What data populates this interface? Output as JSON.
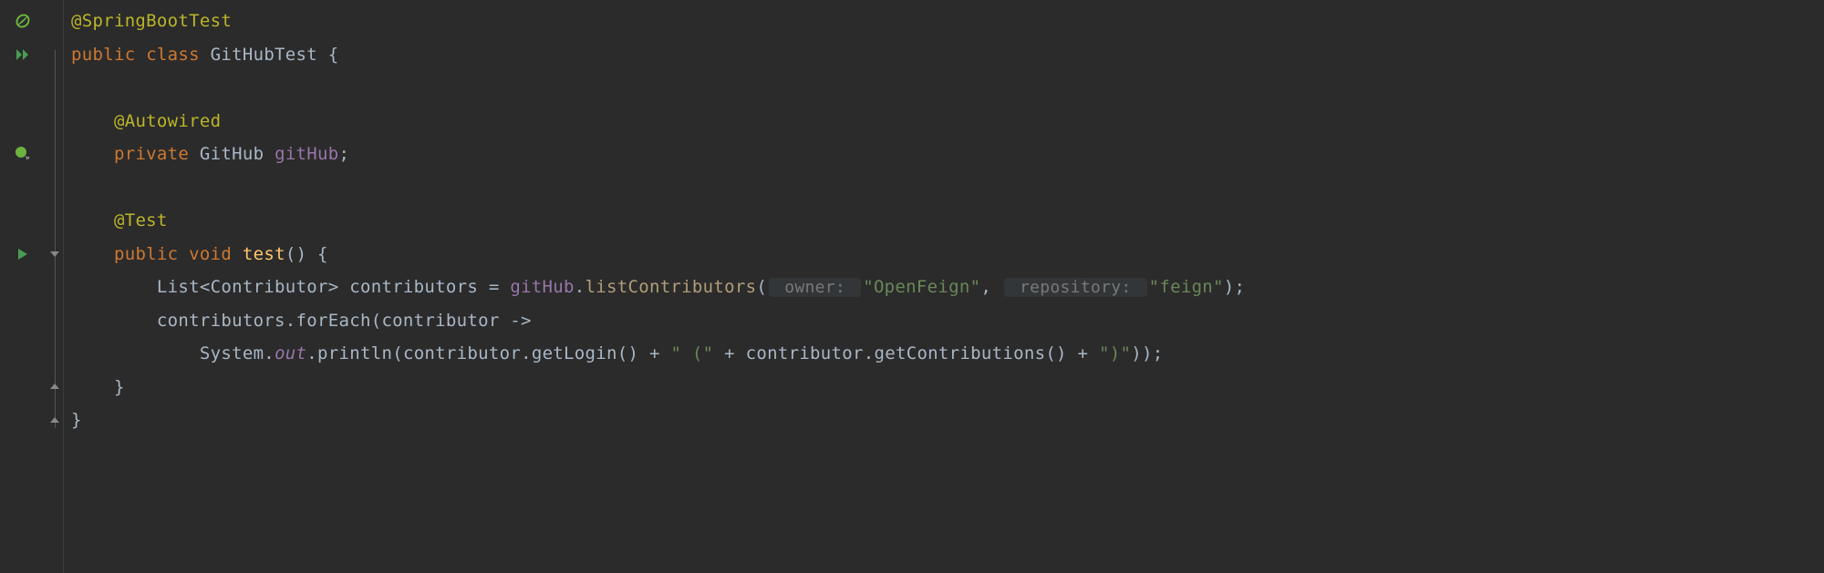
{
  "code": {
    "line1": {
      "annotation": "@SpringBootTest"
    },
    "line2": {
      "kw1": "public ",
      "kw2": "class ",
      "classname": "GitHubTest ",
      "brace": "{"
    },
    "line4": {
      "indent": "    ",
      "annotation": "@Autowired"
    },
    "line5": {
      "indent": "    ",
      "kw": "private ",
      "type": "GitHub ",
      "field": "gitHub",
      "semi": ";"
    },
    "line7": {
      "indent": "    ",
      "annotation": "@Test"
    },
    "line8": {
      "indent": "    ",
      "kw1": "public ",
      "kw2": "void ",
      "method": "test",
      "parens": "() {"
    },
    "line9": {
      "indent": "        ",
      "type": "List<Contributor> ",
      "var": "contributors = ",
      "obj": "gitHub",
      "dot": ".",
      "call": "listContributors",
      "open": "(",
      "hint1": " owner: ",
      "str1": "\"OpenFeign\"",
      "comma": ", ",
      "hint2": " repository: ",
      "str2": "\"feign\"",
      "close": ");"
    },
    "line10": {
      "indent": "        ",
      "var": "contributors.forEach(contributor -> "
    },
    "line11": {
      "indent": "            ",
      "sys": "System.",
      "out": "out",
      "dot": ".",
      "call": "println",
      "open": "(contributor.getLogin() + ",
      "str1": "\" (\"",
      "plus1": " + contributor.getContributions() + ",
      "str2": "\")\"",
      "close": "));"
    },
    "line12": {
      "indent": "    ",
      "brace": "}"
    },
    "line13": {
      "brace": "}"
    }
  }
}
